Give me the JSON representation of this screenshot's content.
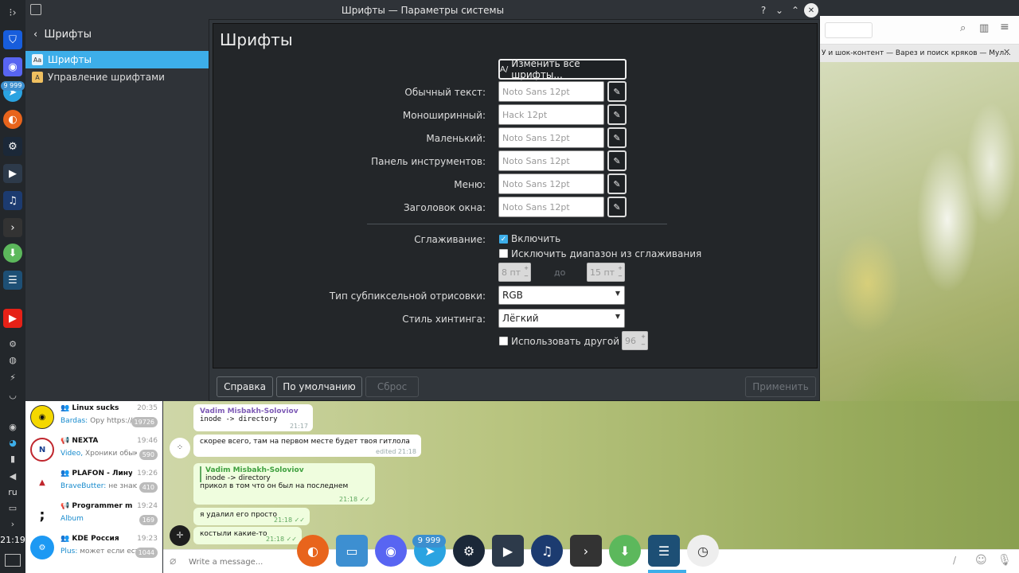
{
  "window": {
    "title": "Шрифты — Параметры системы",
    "buttons": {
      "help": "?",
      "minimize": "⌄",
      "maximize": "⌃",
      "close": "✕"
    }
  },
  "sidebar": {
    "back_label": "Шрифты",
    "items": [
      {
        "label": "Шрифты",
        "selected": true
      },
      {
        "label": "Управление шрифтами",
        "selected": false
      }
    ]
  },
  "main": {
    "title": "Шрифты",
    "change_all_label": "Изменить все шрифты...",
    "font_rows": [
      {
        "label": "Обычный текст:",
        "value": "Noto Sans 12pt"
      },
      {
        "label": "Моноширинный:",
        "value": "Hack 12pt"
      },
      {
        "label": "Маленький:",
        "value": "Noto Sans 12pt"
      },
      {
        "label": "Панель инструментов:",
        "value": "Noto Sans 12pt"
      },
      {
        "label": "Меню:",
        "value": "Noto Sans 12pt"
      },
      {
        "label": "Заголовок окна:",
        "value": "Noto Sans 12pt"
      }
    ],
    "antialias": {
      "label": "Сглаживание:",
      "checkbox_label": "Включить",
      "checked": true
    },
    "exclude_range": {
      "checkbox_label": "Исключить диапазон из сглаживания",
      "checked": false,
      "from": "8 пт",
      "to_label": "до",
      "to": "15 пт"
    },
    "subpixel": {
      "label": "Тип субпиксельной отрисовки:",
      "value": "RGB"
    },
    "hinting": {
      "label": "Стиль хинтинга:",
      "value": "Лёгкий"
    },
    "dpi": {
      "checkbox_label": "Использовать другой DPI:",
      "checked": false,
      "value": "96"
    }
  },
  "footer": {
    "help": "Справка",
    "defaults": "По умолчанию",
    "reset": "Сброс",
    "apply": "Применить"
  },
  "browser": {
    "tab_text": "У и шок-контент — Варез и поиск кряков — Мул..."
  },
  "dock": {
    "badge": "9 999",
    "lang": "ru",
    "time": "21:19"
  },
  "chats": [
    {
      "name": "Linux sucks",
      "time": "20:35",
      "sender": "Bardas:",
      "preview": "Ору https://...",
      "badge": "19726"
    },
    {
      "name": "NEXTA",
      "time": "19:46",
      "sender": "Video,",
      "preview": "Хроники обык...",
      "badge": "590"
    },
    {
      "name": "PLAFON - Линукс...",
      "time": "19:26",
      "sender": "BraveButter:",
      "preview": "не знаю ...",
      "badge": "410"
    },
    {
      "name": "Programmer me...",
      "time": "19:24",
      "sender": "Album",
      "preview": "",
      "badge": "169"
    },
    {
      "name": "KDE Россия",
      "time": "19:23",
      "sender": "Plus:",
      "preview": "может если ест...",
      "badge": "1044"
    }
  ],
  "messages": [
    {
      "author": "Vadim Misbakh-Soloviov",
      "text": "inode -> directory",
      "time": "21:17"
    },
    {
      "text": "скорее всего, там на первом месте будет твоя гитлола",
      "time": "edited 21:18"
    },
    {
      "quote_author": "Vadim Misbakh-Soloviov",
      "quote_text": "inode -> directory",
      "text": "прикол в том что он был на последнем",
      "time": "21:18"
    },
    {
      "text": "я удалил его просто",
      "time": "21:18"
    },
    {
      "text": "костыли какие-то",
      "time": "21:18"
    }
  ],
  "input_placeholder": "Write a message...",
  "taskbar_badge": "9 999"
}
